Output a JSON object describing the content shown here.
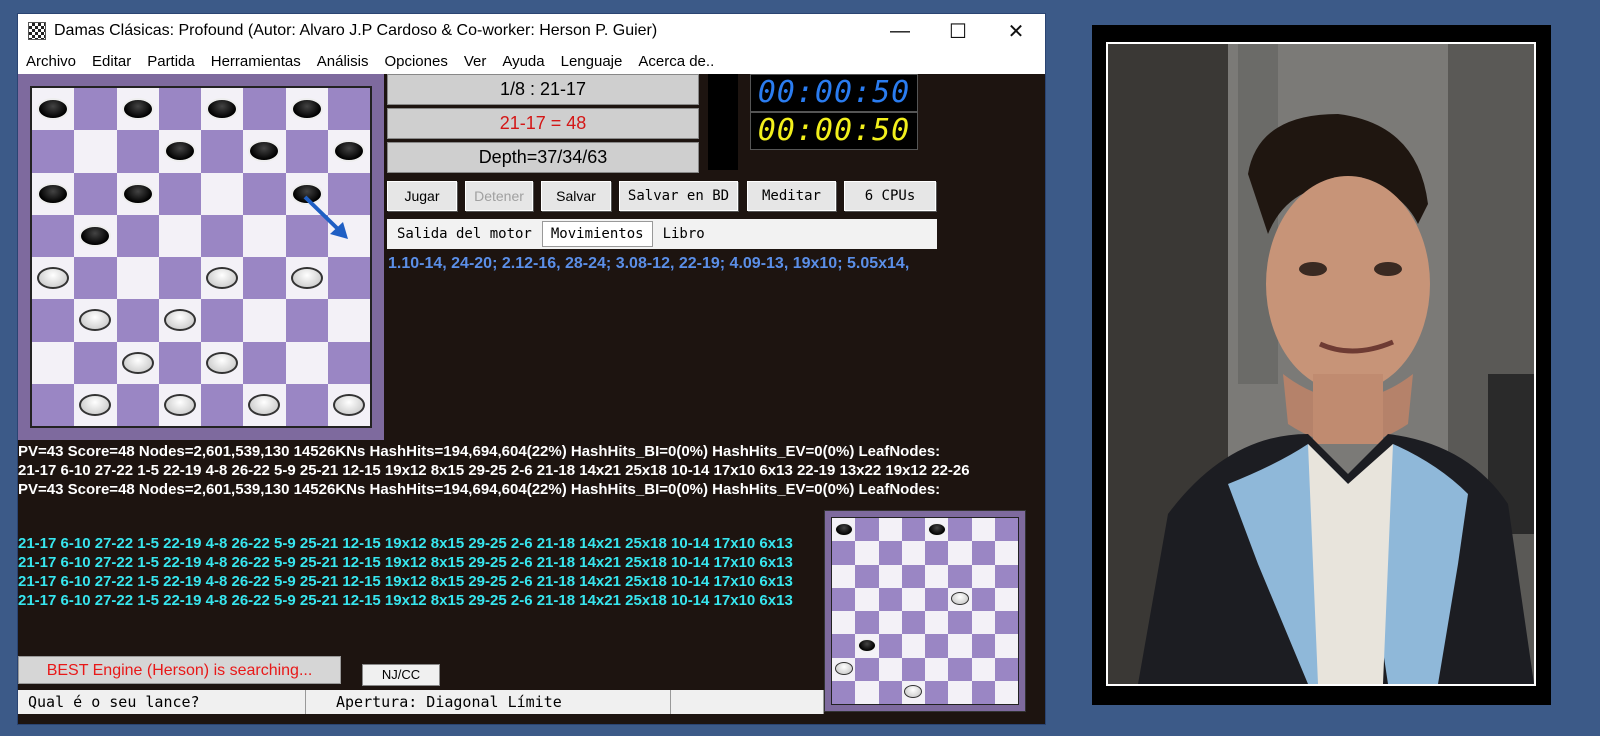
{
  "window": {
    "title": "Damas Clásicas: Profound (Autor: Alvaro J.P Cardoso & Co-worker: Herson P. Guier)",
    "minimize": "—",
    "maximize": "☐",
    "close": "✕"
  },
  "menu": [
    "Archivo",
    "Editar",
    "Partida",
    "Herramientas",
    "Análisis",
    "Opciones",
    "Ver",
    "Ayuda",
    "Lenguaje",
    "Acerca de.."
  ],
  "info": {
    "move_count": "1/8 : 21-17",
    "eval": "21-17 = 48",
    "depth": "Depth=37/34/63"
  },
  "clocks": {
    "top": "00:00:50",
    "bottom": "00:00:50",
    "top_color": "#2a7cf0",
    "bottom_color": "#f2ef1c"
  },
  "buttons": {
    "jugar": "Jugar",
    "detener": "Detener",
    "salvar": "Salvar",
    "salvar_bd": "Salvar en BD",
    "meditar": "Meditar",
    "cpus": "6 CPUs"
  },
  "tabs": {
    "engine": "Salida del motor",
    "moves": "Movimientos",
    "book": "Libro"
  },
  "moves_text": "1.10-14, 24-20; 2.12-16, 28-24; 3.08-12, 22-19; 4.09-13, 19x10; 5.05x14,",
  "pv_lines": [
    "PV=43  Score=48  Nodes=2,601,539,130  14526KNs  HashHits=194,694,604(22%)  HashHits_BI=0(0%)  HashHits_EV=0(0%)  LeafNodes:",
    "21-17 6-10 27-22 1-5 22-19 4-8 26-22 5-9 25-21 12-15 19x12 8x15 29-25 2-6 21-18 14x21 25x18 10-14 17x10 6x13 22-19 13x22 19x12 22-26",
    "PV=43  Score=48  Nodes=2,601,539,130  14526KNs  HashHits=194,694,604(22%)  HashHits_BI=0(0%)  HashHits_EV=0(0%)  LeafNodes:"
  ],
  "cyan_lines": [
    "21-17 6-10 27-22 1-5 22-19 4-8 26-22 5-9 25-21 12-15 19x12 8x15 29-25 2-6 21-18 14x21 25x18 10-14 17x10 6x13",
    "21-17 6-10 27-22 1-5 22-19 4-8 26-22 5-9 25-21 12-15 19x12 8x15 29-25 2-6 21-18 14x21 25x18 10-14 17x10 6x13",
    "21-17 6-10 27-22 1-5 22-19 4-8 26-22 5-9 25-21 12-15 19x12 8x15 29-25 2-6 21-18 14x21 25x18 10-14 17x10 6x13",
    "21-17 6-10 27-22 1-5 22-19 4-8 26-22 5-9 25-21 12-15 19x12 8x15 29-25 2-6 21-18 14x21 25x18 10-14 17x10 6x13"
  ],
  "status": {
    "searching": "BEST Engine (Herson) is searching...",
    "nj": "NJ/CC",
    "question": "Qual é o seu lance?",
    "opening": "Apertura: Diagonal Límite"
  },
  "main_board": [
    [
      "b",
      "",
      "b",
      "",
      "b",
      "",
      "b",
      ""
    ],
    [
      "",
      "",
      "",
      "b",
      "",
      "b",
      "",
      "b"
    ],
    [
      "b",
      "",
      "b",
      "",
      "",
      "",
      "b",
      ""
    ],
    [
      "",
      "b",
      "",
      "",
      "",
      "",
      "",
      ""
    ],
    [
      "w",
      "",
      "",
      "",
      "w",
      "",
      "w",
      ""
    ],
    [
      "",
      "w",
      "",
      "w",
      "",
      "",
      "",
      ""
    ],
    [
      "",
      "",
      "w",
      "",
      "w",
      "",
      "",
      ""
    ],
    [
      "",
      "w",
      "",
      "w",
      "",
      "w",
      "",
      "w"
    ]
  ],
  "small_board": [
    [
      "b",
      "",
      "",
      "",
      "b",
      "",
      "",
      ""
    ],
    [
      "",
      "",
      "",
      "",
      "",
      "",
      "",
      ""
    ],
    [
      "",
      "",
      "",
      "",
      "",
      "",
      "",
      ""
    ],
    [
      "",
      "",
      "",
      "",
      "",
      "w",
      "",
      ""
    ],
    [
      "",
      "",
      "",
      "",
      "",
      "",
      "",
      ""
    ],
    [
      "",
      "b",
      "",
      "",
      "",
      "",
      "",
      ""
    ],
    [
      "w",
      "",
      "",
      "",
      "",
      "",
      "",
      ""
    ],
    [
      "",
      "",
      "",
      "w",
      "",
      "",
      "",
      ""
    ]
  ]
}
